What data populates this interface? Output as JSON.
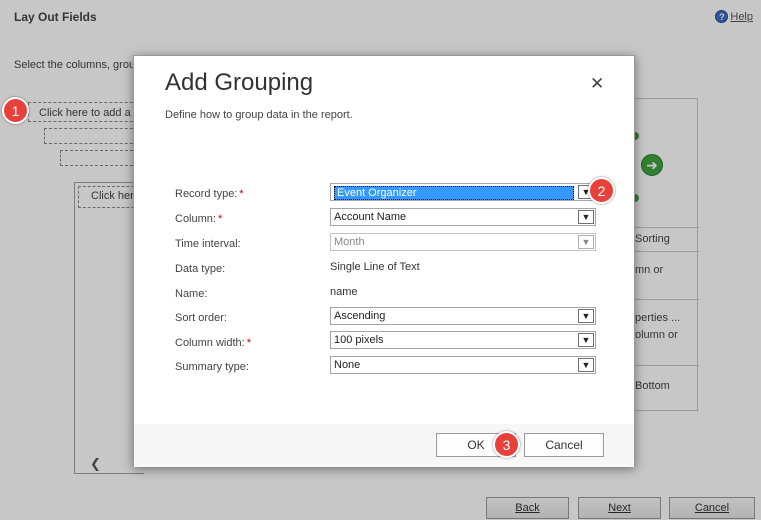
{
  "page": {
    "title": "Lay Out Fields",
    "help_label": "Help",
    "instructions": "Select the columns, grou",
    "click_add_grouping": "Click here to add a",
    "click_add_column": "Click her",
    "right_panel": {
      "row1": "Sorting",
      "row2": "mn or",
      "row3": "perties ...",
      "row4": "olumn or",
      "row5": "Bottom"
    },
    "footer": {
      "back": "Back",
      "next": "Next",
      "cancel": "Cancel"
    }
  },
  "dialog": {
    "title": "Add Grouping",
    "subtitle": "Define how to group data in the report.",
    "fields": {
      "record_type": {
        "label": "Record type:",
        "value": "Event Organizer",
        "required": "*"
      },
      "column": {
        "label": "Column:",
        "value": "Account Name",
        "required": "*"
      },
      "time_interval": {
        "label": "Time interval:",
        "value": "Month"
      },
      "data_type": {
        "label": "Data type:",
        "value": "Single Line of Text"
      },
      "name": {
        "label": "Name:",
        "value": "name"
      },
      "sort_order": {
        "label": "Sort order:",
        "value": "Ascending"
      },
      "column_width": {
        "label": "Column width:",
        "value": "100 pixels",
        "required": "*"
      },
      "summary_type": {
        "label": "Summary type:",
        "value": "None"
      }
    },
    "ok_label": "OK",
    "cancel_label": "Cancel"
  },
  "badges": {
    "one": "1",
    "two": "2",
    "three": "3"
  },
  "icons": {
    "close": "close-icon",
    "dropdown": "chevron-down-icon",
    "help": "help-icon",
    "next_arrow": "arrow-right-icon",
    "scroll_left": "chevron-left-icon"
  },
  "colors": {
    "badge": "#e8403a",
    "selection": "#3399ff",
    "required": "#cc0000",
    "green_arrow": "#3fa33f"
  }
}
